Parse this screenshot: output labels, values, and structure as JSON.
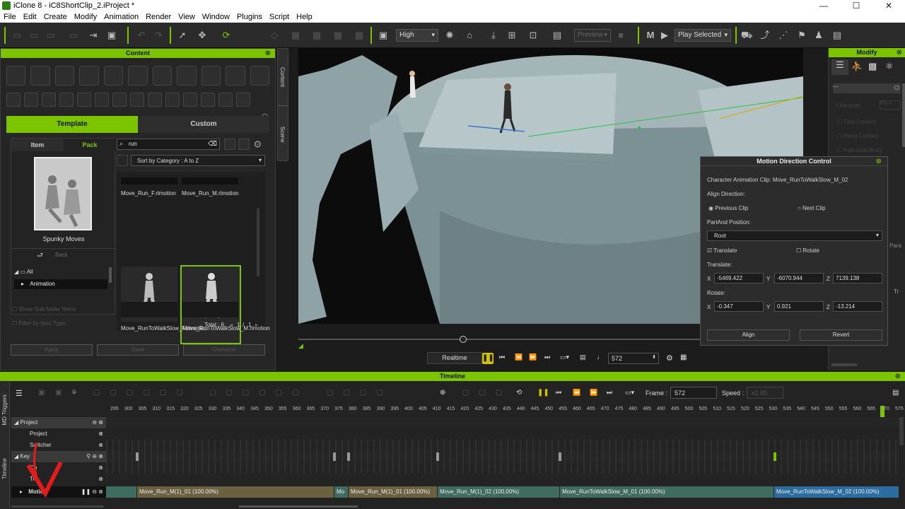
{
  "window": {
    "title": "iClone 8 - iC8ShortClip_2.iProject *",
    "min": "—",
    "max": "☐",
    "close": "✕"
  },
  "menu": [
    "File",
    "Edit",
    "Create",
    "Modify",
    "Animation",
    "Render",
    "View",
    "Window",
    "Plugins",
    "Script",
    "Help"
  ],
  "toolbar": {
    "quality": "High",
    "preview": "Preview",
    "play_mode": "Play Selected"
  },
  "content_panel": {
    "title": "Content",
    "tabs": [
      "Template",
      "Custom"
    ],
    "subtabs": [
      "Item",
      "Pack"
    ],
    "pack_name": "Spunky Moves",
    "search_value": "run",
    "sort": "Sort by Category : A to Z",
    "tree": [
      "All",
      "Animation"
    ],
    "options": [
      "Show Sub-folder Items",
      "Filter by Item Type"
    ],
    "buttons": [
      "Apply",
      "Save",
      "Overwrite"
    ],
    "back": "Back",
    "items": [
      {
        "label": "Move_Run_F.rlmotion"
      },
      {
        "label": "Move_Run_M.rlmotion"
      },
      {
        "label": "Move_RunToWalkSlow_F.rlmotion"
      },
      {
        "label": "Move_RunToWalkSlow_M.rlmotion"
      }
    ],
    "total": "Total : 6",
    "page": "1",
    "pages": "1",
    "side_tabs": [
      "Content",
      "Scene"
    ]
  },
  "modify_panel": {
    "title": "Modify",
    "label": "Cl",
    "fields": [
      "Character",
      "Keen"
    ],
    "options": [
      "Foot Contact",
      "Hand Contact",
      "Individual Body"
    ],
    "para": "Para",
    "tr": "Tr"
  },
  "mdc": {
    "title": "Motion Direction Control",
    "clip_label": "Character Animation Clip: Move_RunToWalkSlow_M_02",
    "align_direction": "Align Direction:",
    "prev_clip": "Previous Clip",
    "next_clip": "Next Clip",
    "part_position": "PartAnd Position:",
    "part": "Root",
    "translate_chk": "Translate",
    "rotate_chk": "Rotate",
    "translate_label": "Translate:",
    "tx": "-5469.422",
    "ty": "-6070.944",
    "tz": "7139.138",
    "rotate_label": "Rotate:",
    "rx": "-0.347",
    "ry": "0.921",
    "rz": "-13.214",
    "x": "X",
    "y": "Y",
    "z": "Z",
    "align_btn": "Align",
    "revert_btn": "Revert"
  },
  "playback": {
    "mode": "Realtime",
    "frame": "572",
    "scrub_fraction": 0.41
  },
  "timeline": {
    "title": "Timeline",
    "frame_label": "Frame :",
    "frame_value": "572",
    "speed_label": "Speed :",
    "speed_value": "x1.00",
    "side_tabs": [
      "MD Triggers",
      "Timeline"
    ],
    "ticks": [
      "295",
      "300",
      "305",
      "310",
      "315",
      "320",
      "325",
      "330",
      "335",
      "340",
      "345",
      "350",
      "355",
      "360",
      "365",
      "370",
      "375",
      "380",
      "385",
      "390",
      "395",
      "400",
      "405",
      "410",
      "415",
      "420",
      "425",
      "430",
      "435",
      "440",
      "445",
      "450",
      "455",
      "460",
      "465",
      "470",
      "475",
      "480",
      "485",
      "490",
      "495",
      "500",
      "505",
      "510",
      "515",
      "520",
      "525",
      "530",
      "535",
      "540",
      "545",
      "550",
      "555",
      "560",
      "565",
      "570",
      "575"
    ],
    "tracks": [
      "Project",
      "Project",
      "Switcher",
      "Key",
      "Co",
      "Tra",
      "Motion"
    ],
    "clips": [
      {
        "label": "Move_Run_M(1)_01 (100.00%)",
        "color": "#6b6140"
      },
      {
        "label": "Mo",
        "color": "#3f6b60"
      },
      {
        "label": "Move_Run_M(1)_01 (100.00%)",
        "color": "#6b6140"
      },
      {
        "label": "Move_Run_M(1)_02 (100.00%)",
        "color": "#3f6b60"
      },
      {
        "label": "Move_RunToWalkSlow_M_01 (100.00%)",
        "color": "#3f6b60"
      },
      {
        "label": "Move_RunToWalkSlow_M_02 (100.00%)",
        "color": "#2b6da0"
      }
    ]
  },
  "colors": {
    "accent": "#7cc400",
    "panel": "#262626",
    "dark": "#1c1c1c"
  }
}
